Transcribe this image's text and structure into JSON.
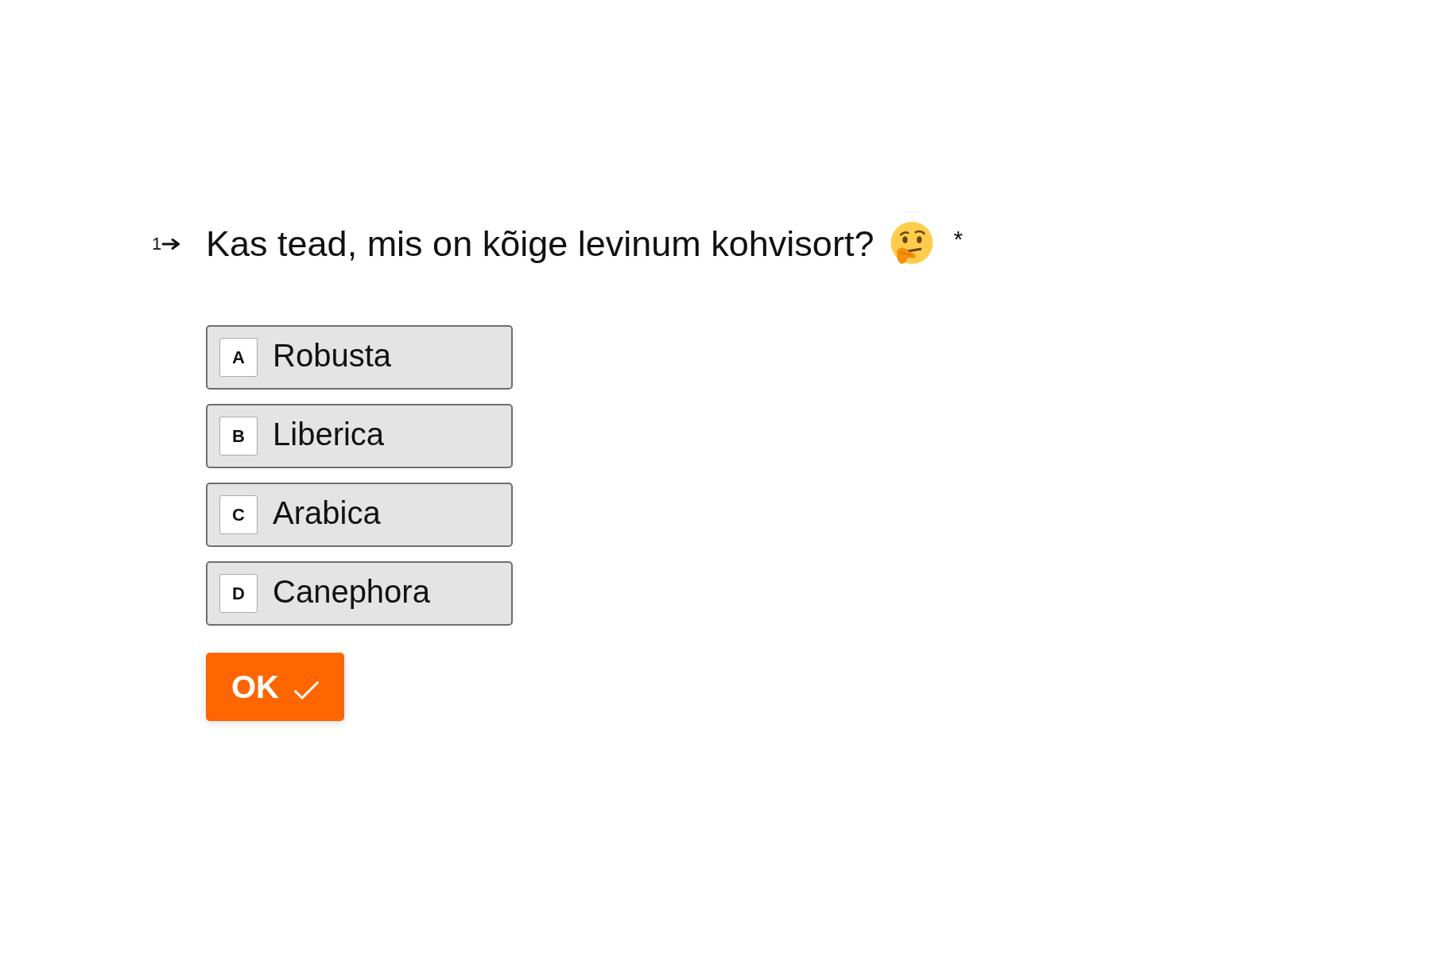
{
  "question": {
    "number": "1",
    "text": "Kas tead, mis on kõige levinum kohvisort?",
    "required_mark": "*"
  },
  "choices": [
    {
      "key": "A",
      "label": "Robusta",
      "selected": false
    },
    {
      "key": "B",
      "label": "Liberica",
      "selected": false
    },
    {
      "key": "C",
      "label": "Arabica",
      "selected": false
    },
    {
      "key": "D",
      "label": "Canephora",
      "selected": false
    }
  ],
  "submit_button": {
    "label": "OK"
  }
}
